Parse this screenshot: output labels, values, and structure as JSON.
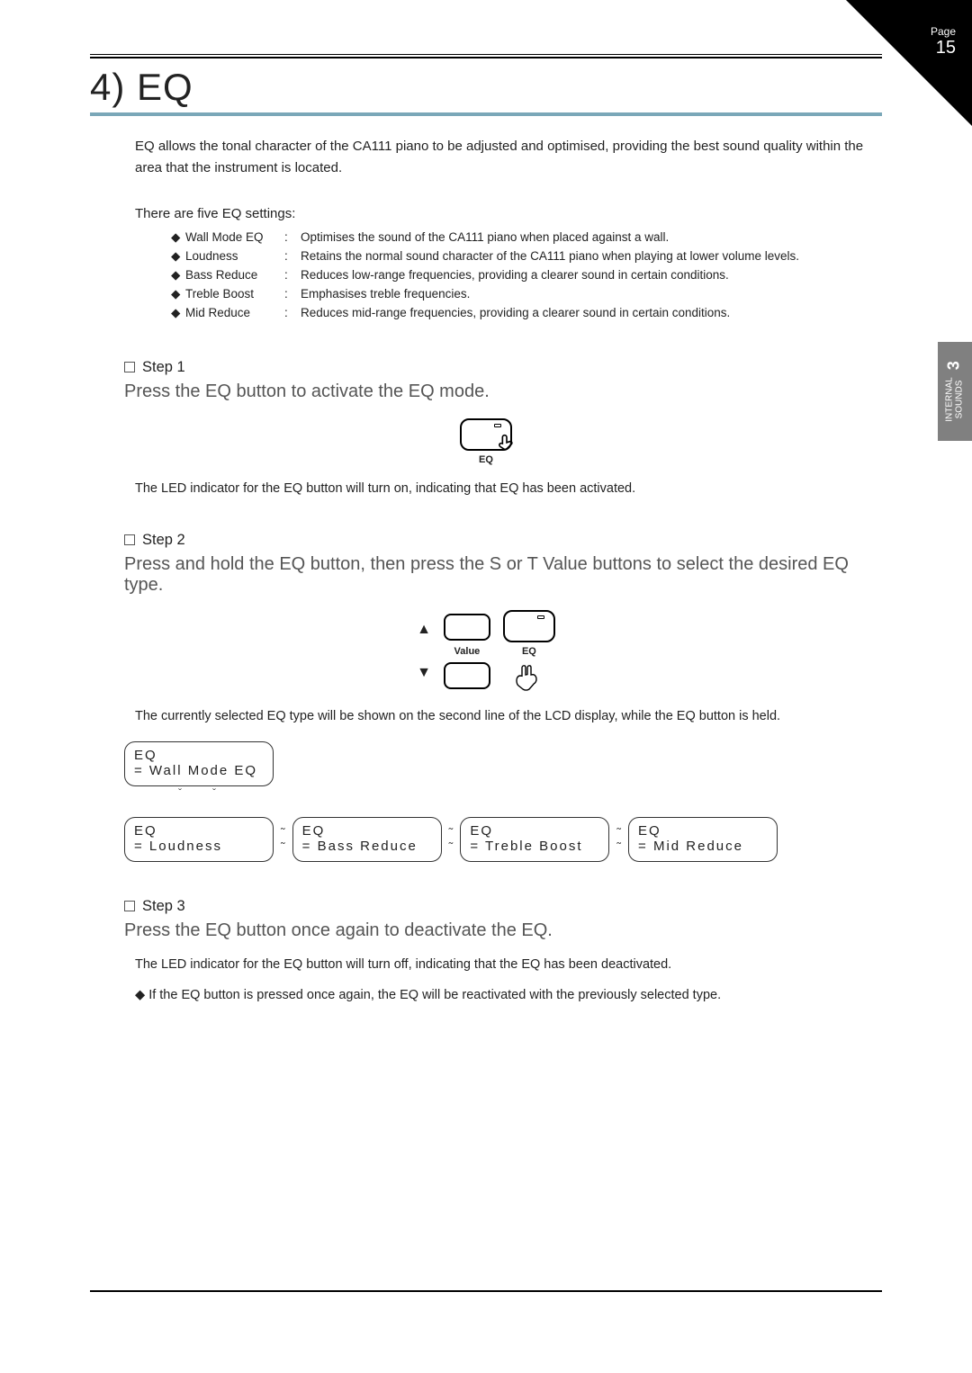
{
  "page": {
    "label": "Page",
    "number": "15"
  },
  "sideTab": {
    "line1": "INTERNAL",
    "line2": "SOUNDS",
    "section": "3"
  },
  "header": {
    "title": "4) EQ"
  },
  "intro": "EQ allows the tonal character of the CA111 piano to be adjusted and optimised, providing the best sound quality within the area that the instrument is located.",
  "settingsLead": "There are five EQ settings:",
  "settings": [
    {
      "name": "Wall Mode EQ",
      "desc": "Optimises the sound of the CA111 piano when placed against a wall."
    },
    {
      "name": "Loudness",
      "desc": "Retains the normal sound character of the CA111 piano when playing at lower volume levels."
    },
    {
      "name": "Bass Reduce",
      "desc": "Reduces low-range frequencies, providing a clearer sound in certain conditions."
    },
    {
      "name": "Treble Boost",
      "desc": "Emphasises treble frequencies."
    },
    {
      "name": "Mid Reduce",
      "desc": "Reduces mid-range frequencies, providing a clearer sound in certain conditions."
    }
  ],
  "step1": {
    "label": "Step 1",
    "instr": "Press the EQ button to activate the EQ mode.",
    "buttonLabel": "EQ",
    "note": "The LED indicator for the EQ button will turn on, indicating that EQ has been activated."
  },
  "step2": {
    "label": "Step 2",
    "instr": "Press and hold the EQ button, then press the  S or  T Value buttons to select the desired EQ type.",
    "valueLabel": "Value",
    "eqLabel": "EQ",
    "upArrow": "▲",
    "downArrow": "▼",
    "note": "The currently selected EQ type will be shown on the second line of the LCD display, while the EQ button is held.",
    "lcdTop": {
      "l1": "EQ",
      "l2": "= Wall Mode EQ"
    },
    "lcds": [
      {
        "l1": "EQ",
        "l2": "= Loudness"
      },
      {
        "l1": "EQ",
        "l2": "= Bass Reduce"
      },
      {
        "l1": "EQ",
        "l2": "= Treble Boost"
      },
      {
        "l1": "EQ",
        "l2": "= Mid Reduce"
      }
    ],
    "sep": "˜"
  },
  "step3": {
    "label": "Step 3",
    "instr": "Press the EQ button once again to deactivate the EQ.",
    "note": "The LED indicator for the EQ button will turn off, indicating that the EQ has been deactivated.",
    "bullet": "If the EQ button is pressed once again, the EQ will be reactivated with the previously selected type."
  },
  "glyphs": {
    "diamond": "◆"
  }
}
